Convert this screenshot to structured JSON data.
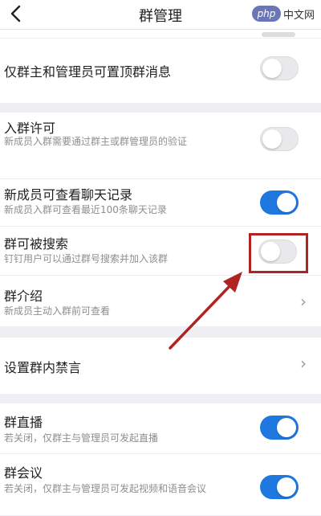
{
  "header": {
    "title": "群管理",
    "back_icon": "chevron-left-icon"
  },
  "watermark": {
    "logo": "php",
    "text": "中文网"
  },
  "settings": {
    "pin_messages": {
      "title": "仅群主和管理员可置顶群消息",
      "enabled": false
    },
    "join_approval": {
      "title": "入群许可",
      "subtitle": "新成员入群需要通过群主或群管理员的验证",
      "enabled": false
    },
    "history_visible": {
      "title": "新成员可查看聊天记录",
      "subtitle": "新成员入群可查看最近100条聊天记录",
      "enabled": true
    },
    "searchable": {
      "title": "群可被搜索",
      "subtitle": "钉钉用户可以通过群号搜索并加入该群",
      "enabled": false
    },
    "intro": {
      "title": "群介绍",
      "subtitle": "新成员主动入群前可查看"
    },
    "mute": {
      "title": "设置群内禁言"
    },
    "live": {
      "title": "群直播",
      "subtitle": "若关闭，仅群主与管理员可发起直播",
      "enabled": true
    },
    "meeting": {
      "title": "群会议",
      "subtitle": "若关闭，仅群主与管理员可发起视频和语音会议",
      "enabled": true
    }
  },
  "annotation": {
    "color": "#b02323"
  }
}
